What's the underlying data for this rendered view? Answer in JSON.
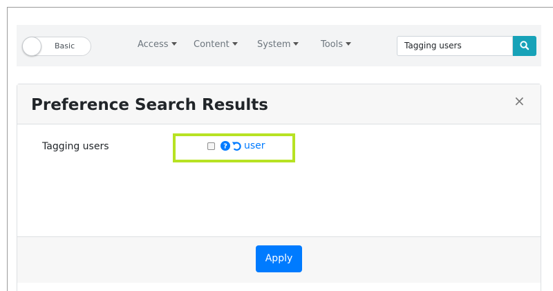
{
  "navbar": {
    "mode_toggle_label": "Basic",
    "menus": [
      {
        "label": "Access"
      },
      {
        "label": "Content"
      },
      {
        "label": "System"
      },
      {
        "label": "Tools"
      }
    ],
    "search_value": "Tagging users"
  },
  "panel": {
    "title": "Preference Search Results",
    "close_symbol": "×",
    "preference": {
      "label": "Tagging users",
      "value_link": "user"
    },
    "apply_label": "Apply"
  },
  "colors": {
    "search_button": "#17a2b8",
    "primary": "#007bff",
    "highlight": "#b7e223"
  }
}
